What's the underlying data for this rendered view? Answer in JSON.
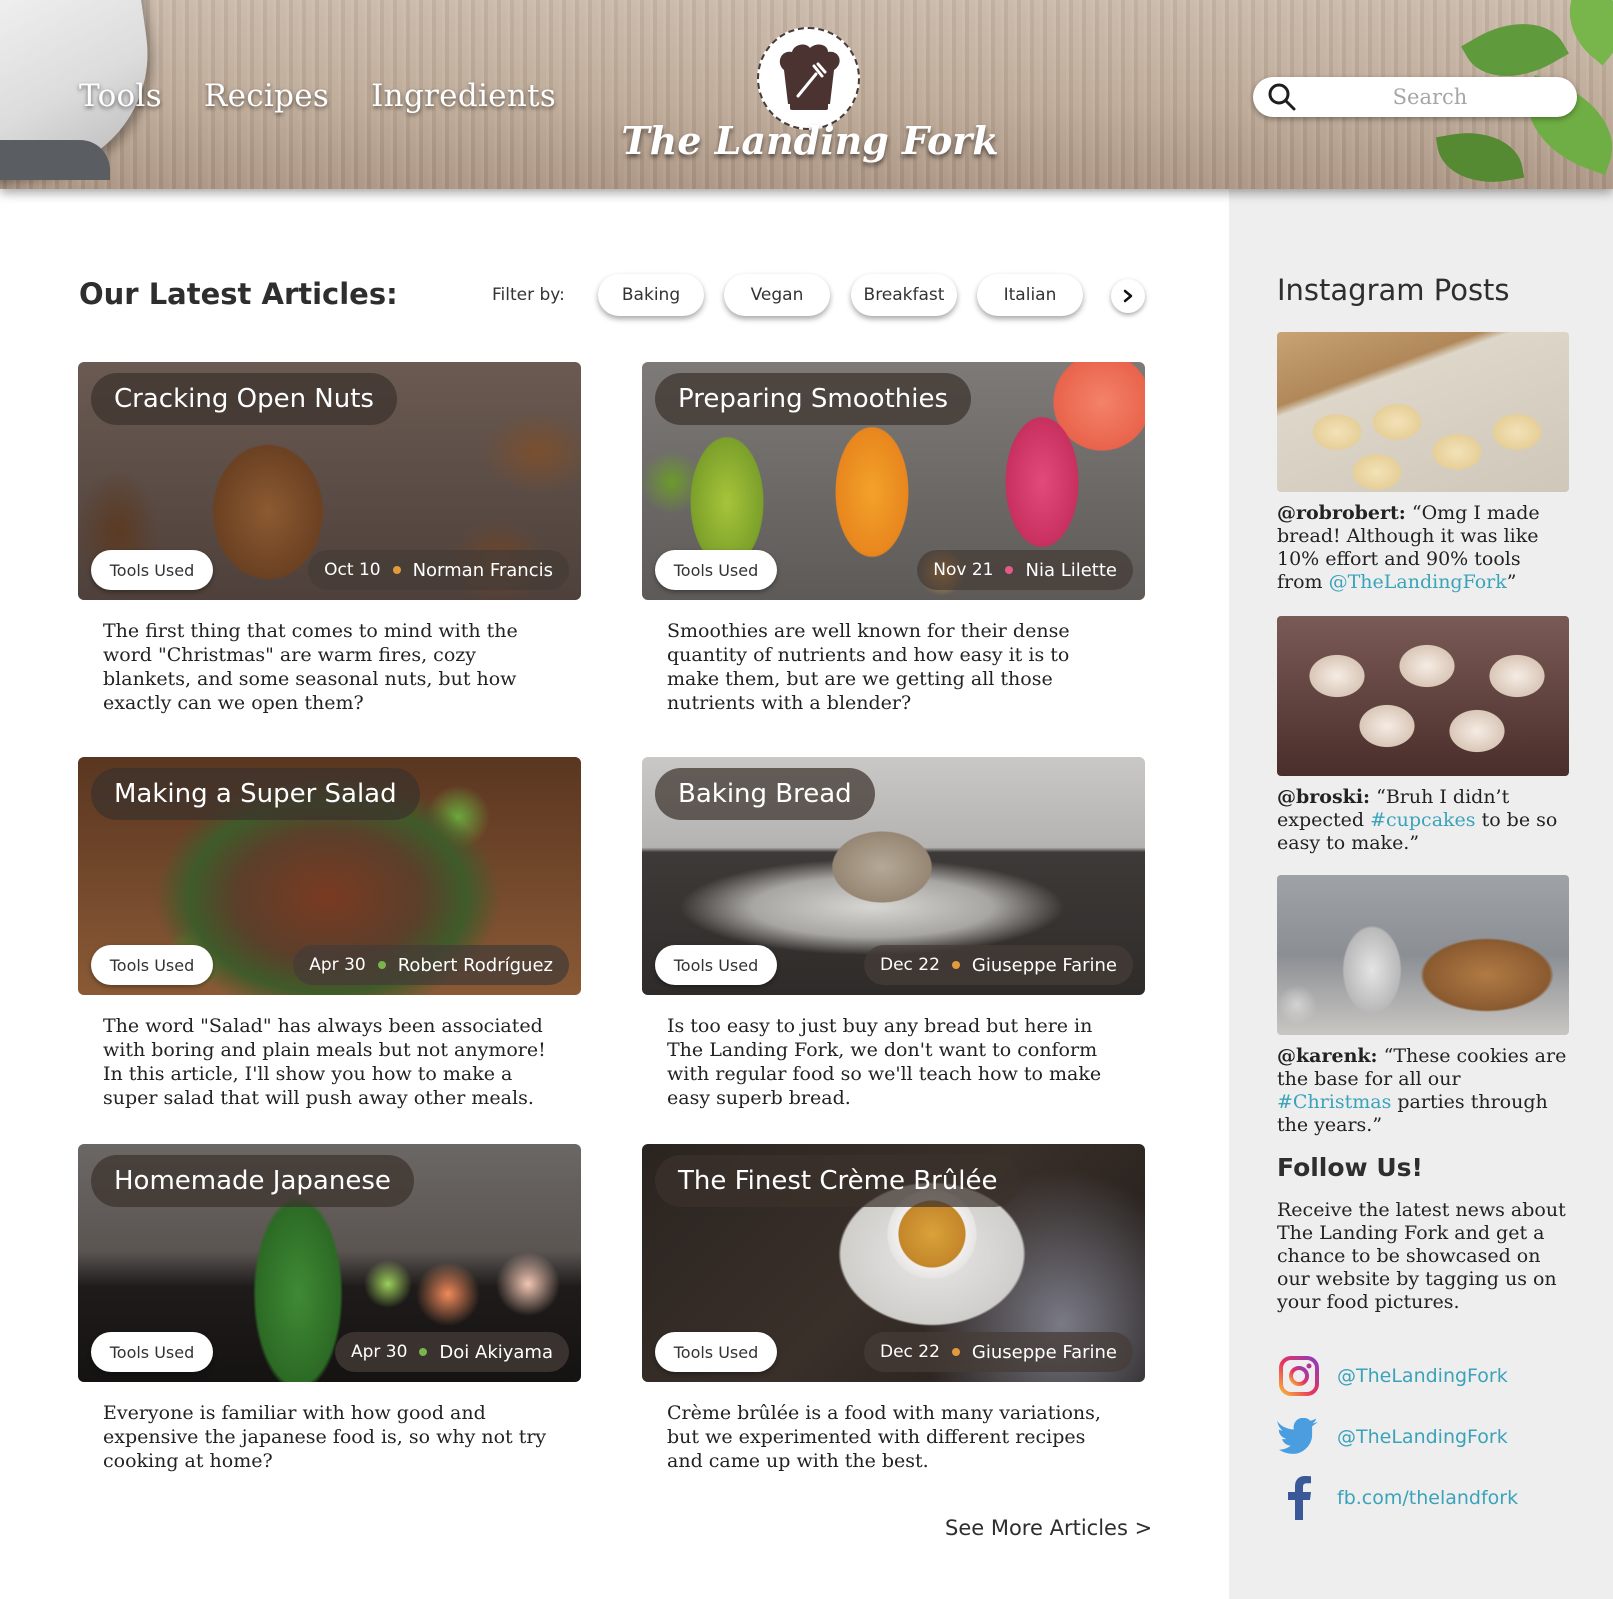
{
  "header": {
    "nav": [
      "Tools",
      "Recipes",
      "Ingredients"
    ],
    "brand": "The Landing Fork",
    "search_placeholder": "Search"
  },
  "main": {
    "section_title": "Our Latest Articles:",
    "filter_label": "Filter by:",
    "filters": [
      "Baking",
      "Vegan",
      "Breakfast",
      "Italian"
    ],
    "tools_label": "Tools Used",
    "articles": [
      {
        "title": "Cracking Open Nuts",
        "date": "Oct 10",
        "author": "Norman Francis",
        "dot_color": "#e39a3c",
        "excerpt": "The first thing that comes to mind with the word \"Christmas\" are warm fires, cozy blankets, and some seasonal nuts, but how exactly can we open them?"
      },
      {
        "title": "Preparing Smoothies",
        "date": "Nov 21",
        "author": "Nia Lilette",
        "dot_color": "#e25a8a",
        "excerpt": "Smoothies are well known for their dense quantity of nutrients and how easy it is to make them, but are we getting all those nutrients with a blender?"
      },
      {
        "title": "Making a Super Salad",
        "date": "Apr 30",
        "author": "Robert Rodríguez",
        "dot_color": "#79b54a",
        "excerpt": "The word \"Salad\" has always been associated with boring and plain meals but not anymore! In this article, I'll show you how to make a super salad that will push away other meals."
      },
      {
        "title": "Baking Bread",
        "date": "Dec 22",
        "author": "Giuseppe Farine",
        "dot_color": "#e39a3c",
        "excerpt": "Is too easy to just buy any bread but here in The Landing Fork, we don't want to conform with regular food so we'll teach how to make easy superb bread."
      },
      {
        "title": "Homemade Japanese",
        "date": "Apr 30",
        "author": "Doi Akiyama",
        "dot_color": "#79b54a",
        "excerpt": "Everyone is familiar with how good and expensive the japanese food is, so why not try cooking at home?"
      },
      {
        "title": "The Finest Crème Brûlée",
        "date": "Dec 22",
        "author": "Giuseppe Farine",
        "dot_color": "#e39a3c",
        "excerpt": "Crème brûlée is a food with many variations, but we experimented with different recipes and came up with the best."
      }
    ],
    "see_more": "See More Articles >"
  },
  "sidebar": {
    "title": "Instagram Posts",
    "posts": [
      {
        "user": "@robrobert:",
        "text_before": " “Omg I made bread! Although it was like 10% effort and 90% tools from ",
        "highlight": "@TheLandingFork",
        "text_after": "”"
      },
      {
        "user": "@broski:",
        "text_before": " “Bruh I didn’t expected ",
        "highlight": "#cupcakes",
        "text_after": " to be so easy to make.”"
      },
      {
        "user": "@karenk:",
        "text_before": " “These cookies are the base for all our ",
        "highlight": "#Christmas",
        "text_after": " parties through the years.”"
      }
    ],
    "follow_title": "Follow Us!",
    "follow_text": "Receive the latest news about The Landing Fork and get a chance to be showcased on our website by tagging us on your food pictures.",
    "social": [
      {
        "icon": "instagram-icon",
        "label": "@TheLandingFork"
      },
      {
        "icon": "twitter-icon",
        "label": "@TheLandingFork"
      },
      {
        "icon": "facebook-icon",
        "label": "fb.com/thelandfork"
      }
    ],
    "accent_color": "#3aa3b9"
  }
}
